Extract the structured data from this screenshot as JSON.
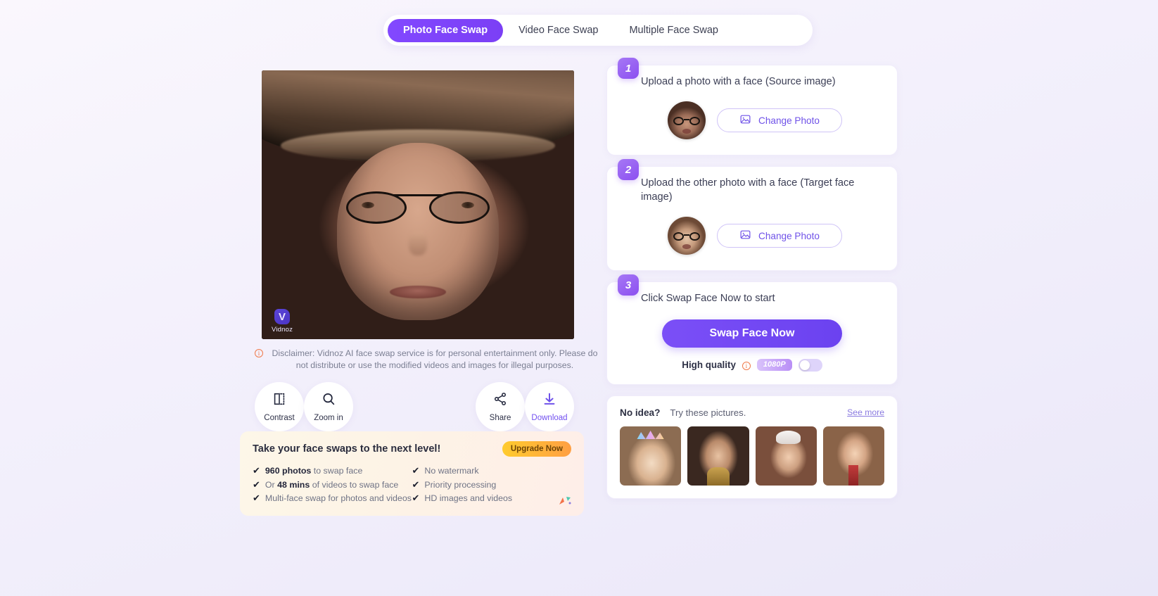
{
  "tabs": [
    {
      "label": "Photo Face Swap",
      "active": true
    },
    {
      "label": "Video Face Swap",
      "active": false
    },
    {
      "label": "Multiple Face Swap",
      "active": false
    }
  ],
  "preview": {
    "watermark_mark": "V",
    "watermark_text": "Vidnoz"
  },
  "disclaimer": {
    "icon": "info-circle-icon",
    "text": "Disclaimer: Vidnoz AI face swap service is for personal entertainment only. Please do not distribute or use the modified videos and images for illegal purposes."
  },
  "toolbar": {
    "contrast_label": "Contrast",
    "zoom_in_label": "Zoom in",
    "share_label": "Share",
    "download_label": "Download"
  },
  "promo": {
    "title": "Take your face swaps to the next level!",
    "upgrade_label": "Upgrade Now",
    "left_items": [
      {
        "bold": "960 photos",
        "rest": " to swap face"
      },
      {
        "bold": "Or 48 mins",
        "rest": " of videos to swap face",
        "pre": "Or ",
        "bold_only": "48 mins",
        "post": " of videos to swap face"
      },
      {
        "bold": "",
        "rest": "Multi-face swap for photos and videos"
      }
    ],
    "right_items": [
      "No watermark",
      "Priority processing",
      "HD images and videos"
    ]
  },
  "steps": {
    "step1": {
      "number": "1",
      "title": "Upload a photo with a face (Source image)",
      "change_label": "Change Photo"
    },
    "step2": {
      "number": "2",
      "title": "Upload the other photo with a face (Target face image)",
      "change_label": "Change Photo"
    },
    "step3": {
      "number": "3",
      "title": "Click Swap Face Now to start",
      "swap_label": "Swap Face Now",
      "high_quality_label": "High quality",
      "quality_badge": "1080P",
      "toggle_on": false
    }
  },
  "ideas": {
    "no_idea_label": "No idea?",
    "try_label": "Try these pictures.",
    "see_more_label": "See more",
    "items": [
      "idea-thumb-1",
      "idea-thumb-2",
      "idea-thumb-3",
      "idea-thumb-4"
    ]
  },
  "colors": {
    "accent": "#7b4ff7",
    "accent_light": "#a678f5",
    "page_bg": "#f1eefb",
    "promo_bg": "#fdf3e6",
    "upgrade_gradient_start": "#ffcb2e",
    "upgrade_gradient_end": "#ff9f43",
    "info_orange": "#f07a4a"
  }
}
